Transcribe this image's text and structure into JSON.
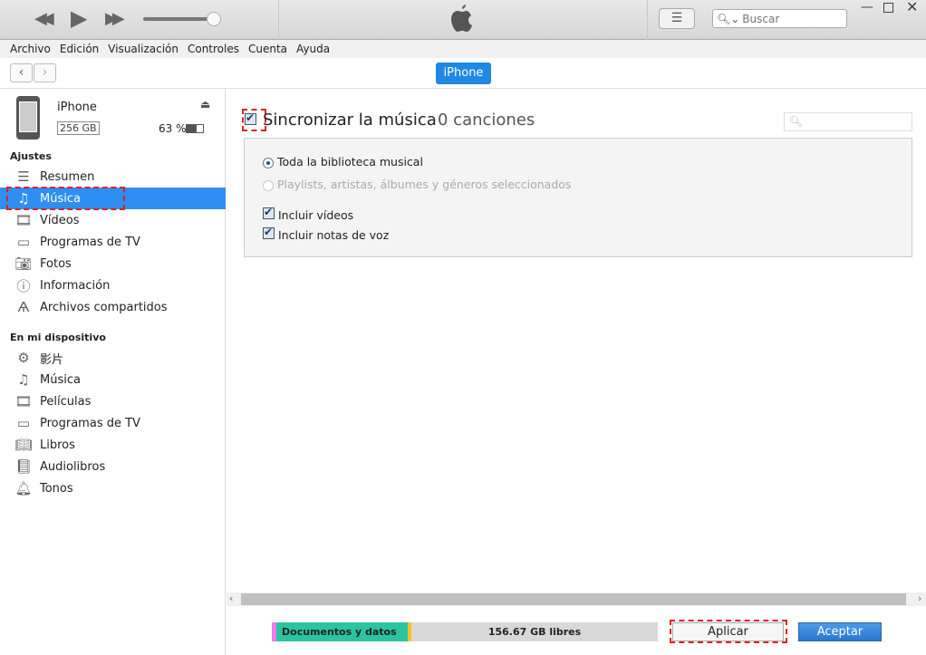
{
  "toolbar": {
    "search_placeholder": "Buscar",
    "volume_percent": 90
  },
  "menu": [
    "Archivo",
    "Edición",
    "Visualización",
    "Controles",
    "Cuenta",
    "Ayuda"
  ],
  "device_tab": "iPhone",
  "device": {
    "name": "iPhone",
    "capacity": "256 GB",
    "battery": "63 %",
    "battery_level": 63
  },
  "sidebar": {
    "settings_header": "Ajustes",
    "settings": [
      {
        "label": "Resumen"
      },
      {
        "label": "Música"
      },
      {
        "label": "Vídeos"
      },
      {
        "label": "Programas de TV"
      },
      {
        "label": "Fotos"
      },
      {
        "label": "Información"
      },
      {
        "label": "Archivos compartidos"
      }
    ],
    "device_header": "En mi dispositivo",
    "device_items": [
      {
        "label": "影片"
      },
      {
        "label": "Música"
      },
      {
        "label": "Películas"
      },
      {
        "label": "Programas de TV"
      },
      {
        "label": "Libros"
      },
      {
        "label": "Audiolibros"
      },
      {
        "label": "Tonos"
      }
    ]
  },
  "main": {
    "sync_label": "Sincronizar la música",
    "song_count": "0 canciones",
    "opt_all": "Toda la biblioteca musical",
    "opt_selected": "Playlists, artistas, álbumes y géneros seleccionados",
    "include_videos": "Incluir vídeos",
    "include_voice": "Incluir notas de voz"
  },
  "storage": {
    "docs_label": "Documentos y datos",
    "free_label": "156.67 GB libres",
    "colors": {
      "pink": "#f07bf0",
      "docs": "#2cc4a0",
      "yellow": "#f5c023",
      "free": "#d8d8d8"
    }
  },
  "buttons": {
    "apply": "Aplicar",
    "accept": "Aceptar"
  }
}
